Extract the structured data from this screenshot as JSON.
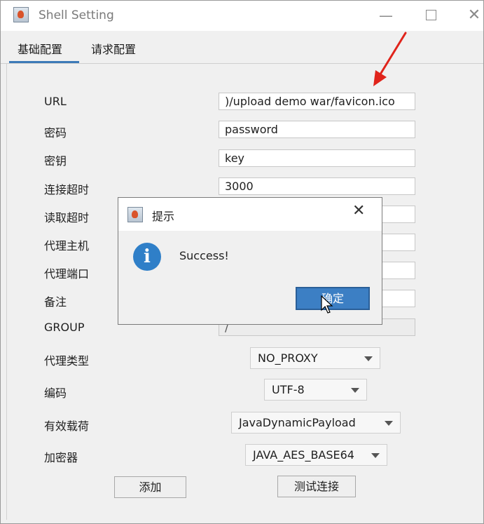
{
  "window": {
    "title": "Shell Setting",
    "minimize": "—",
    "close": "✕"
  },
  "tabs": [
    {
      "label": "基础配置",
      "active": true
    },
    {
      "label": "请求配置",
      "active": false
    }
  ],
  "form": {
    "fields": [
      {
        "label": "URL",
        "value": ")/upload demo war/favicon.ico"
      },
      {
        "label": "密码",
        "value": "password"
      },
      {
        "label": "密钥",
        "value": "key"
      },
      {
        "label": "连接超时",
        "value": "3000"
      },
      {
        "label": "读取超时",
        "value": ""
      },
      {
        "label": "代理主机",
        "value": ""
      },
      {
        "label": "代理端口",
        "value": ""
      },
      {
        "label": "备注",
        "value": ""
      },
      {
        "label": "GROUP",
        "value": "/"
      }
    ],
    "proxy_type": {
      "label": "代理类型",
      "value": "NO_PROXY"
    },
    "encoding": {
      "label": "编码",
      "value": "UTF-8"
    },
    "payload": {
      "label": "有效载荷",
      "value": "JavaDynamicPayload"
    },
    "cryptor": {
      "label": "加密器",
      "value": "JAVA_AES_BASE64"
    },
    "add_button": "添加",
    "test_button": "测试连接"
  },
  "dialog": {
    "title": "提示",
    "close": "✕",
    "icon": "info-icon",
    "info_glyph": "i",
    "message": "Success!",
    "ok_button": "确定"
  },
  "colors": {
    "accent": "#3d7ab8",
    "ok_button": "#3c7fc4",
    "info_icon": "#2f7fc8",
    "annotation_arrow": "#e0241b"
  }
}
